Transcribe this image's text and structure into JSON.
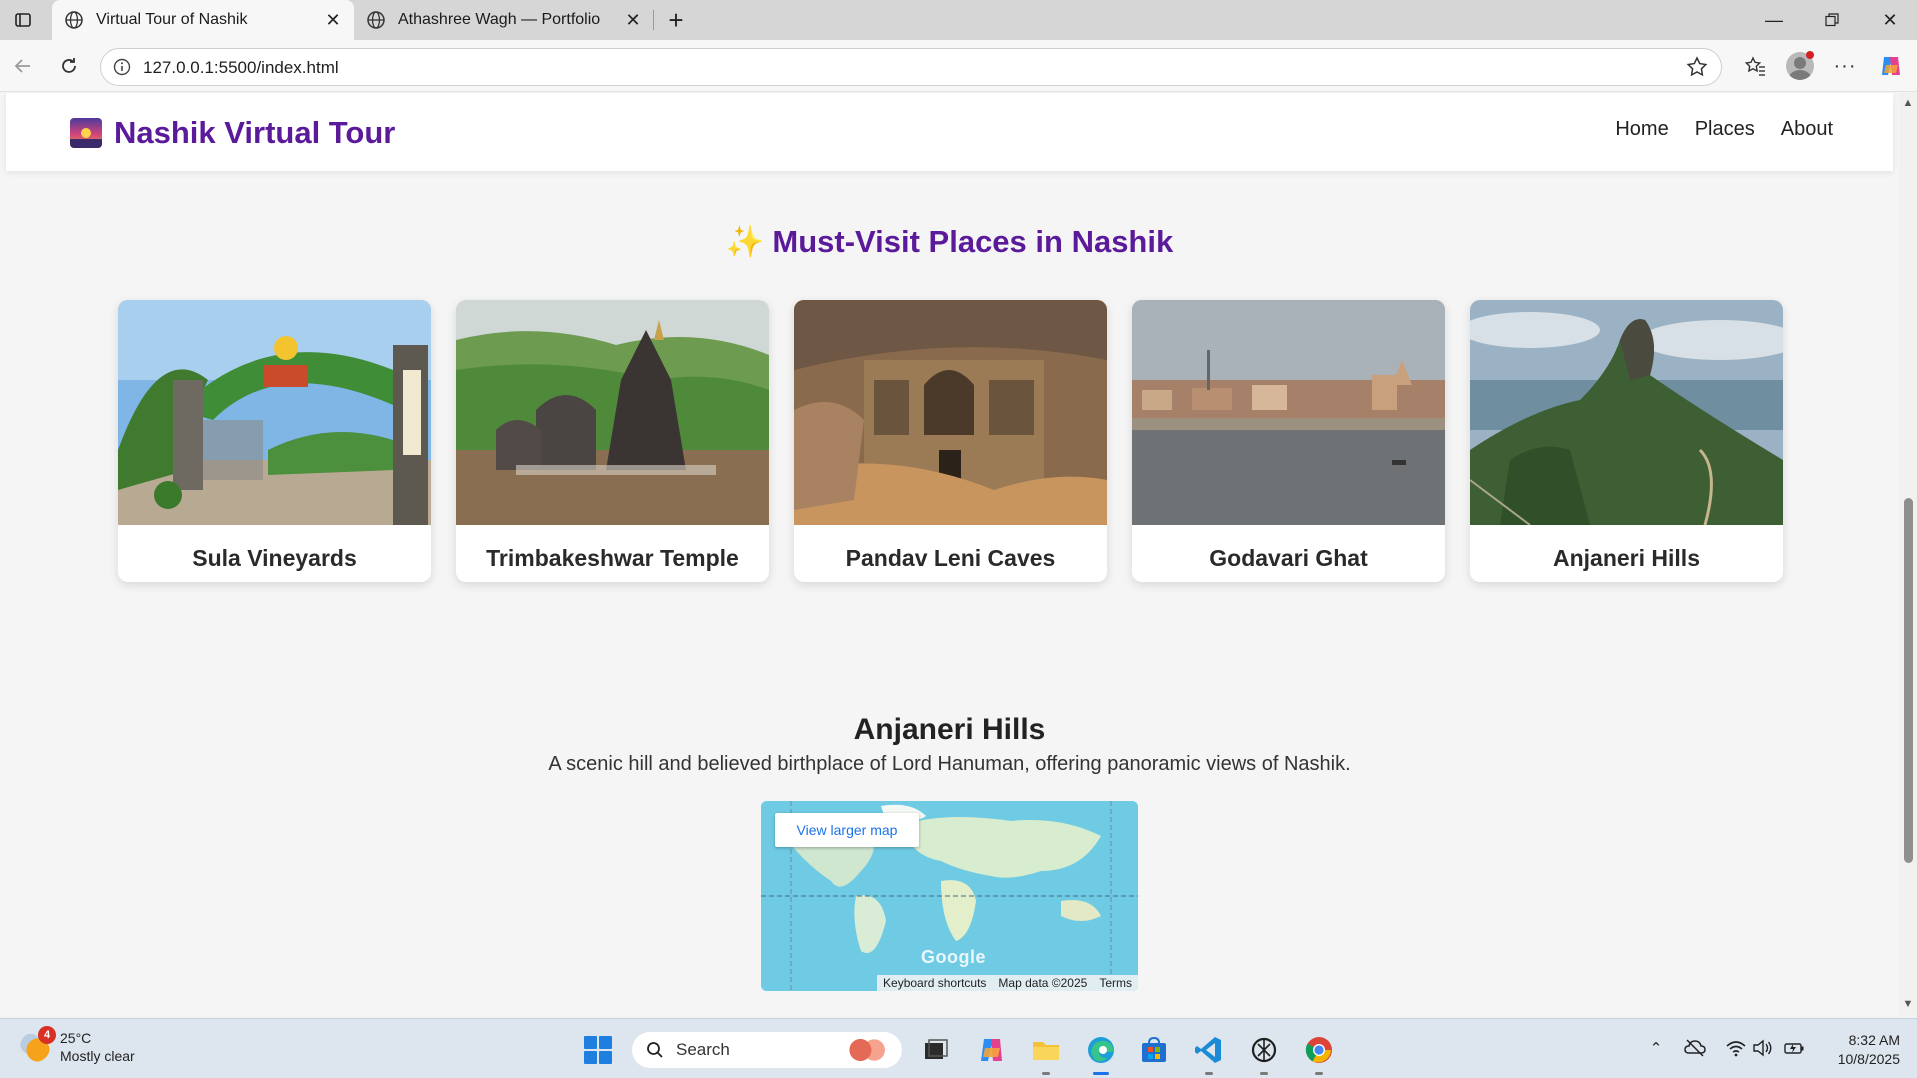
{
  "browser": {
    "tabs": [
      {
        "label": "Virtual Tour of Nashik",
        "active": true
      },
      {
        "label": "Athashree Wagh — Portfolio",
        "active": false
      }
    ],
    "address": "127.0.0.1:5500/index.html"
  },
  "site": {
    "brand": "Nashik Virtual Tour",
    "nav": [
      "Home",
      "Places",
      "About"
    ],
    "section_title": "Must-Visit Places in Nashik",
    "sparkle": "✨",
    "places": [
      {
        "name": "Sula Vineyards",
        "scene": "vineyard-gate"
      },
      {
        "name": "Trimbakeshwar Temple",
        "scene": "temple"
      },
      {
        "name": "Pandav Leni Caves",
        "scene": "caves"
      },
      {
        "name": "Godavari Ghat",
        "scene": "river-ghat"
      },
      {
        "name": "Anjaneri Hills",
        "scene": "mountain"
      }
    ],
    "selected": {
      "title": "Anjaneri Hills",
      "description": "A scenic hill and believed birthplace of Lord Hanuman, offering panoramic views of Nashik."
    },
    "map": {
      "button": "View larger map",
      "logo": "Google",
      "footer": [
        "Keyboard shortcuts",
        "Map data ©2025",
        "Terms"
      ]
    }
  },
  "taskbar": {
    "weather": {
      "temp": "25°C",
      "condition": "Mostly clear",
      "badge": "4"
    },
    "search_placeholder": "Search",
    "time": "8:32 AM",
    "date": "10/8/2025"
  }
}
